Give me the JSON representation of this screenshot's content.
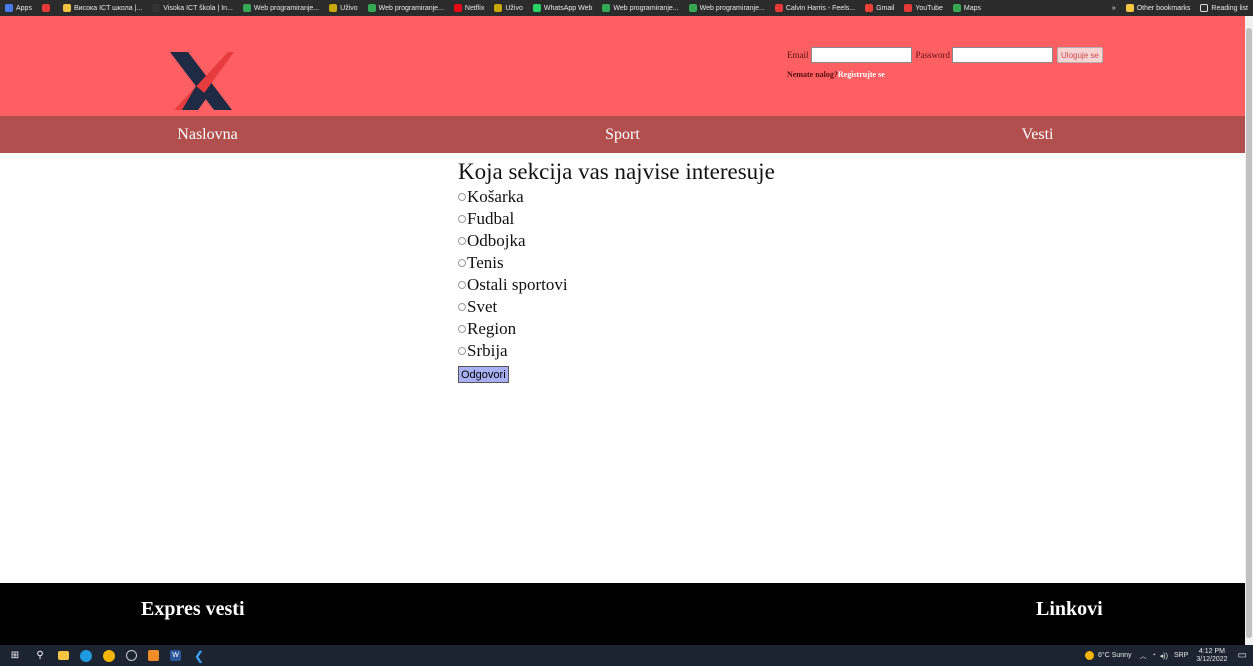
{
  "bookmarks": {
    "items": [
      {
        "label": "Apps",
        "color": "#4a7cf0"
      },
      {
        "label": "",
        "color": "#e53935"
      },
      {
        "label": "Висока ICT школа |...",
        "color": "#f0c040"
      },
      {
        "label": "Visoka ICT škola | In...",
        "color": "#333333"
      },
      {
        "label": "Web programiranje...",
        "color": "#34a853"
      },
      {
        "label": "Uživo",
        "color": "#c8a700"
      },
      {
        "label": "Web programiranje...",
        "color": "#34a853"
      },
      {
        "label": "Netflix",
        "color": "#e50914"
      },
      {
        "label": "Uživo",
        "color": "#c8a700"
      },
      {
        "label": "WhatsApp Web",
        "color": "#25d366"
      },
      {
        "label": "Web programiranje...",
        "color": "#34a853"
      },
      {
        "label": "Web programiranje...",
        "color": "#34a853"
      },
      {
        "label": "Calvin Harris - Feels...",
        "color": "#e53935"
      },
      {
        "label": "Gmail",
        "color": "#ea4335"
      },
      {
        "label": "YouTube",
        "color": "#e53935"
      },
      {
        "label": "Maps",
        "color": "#34a853"
      }
    ],
    "more": "»",
    "other_bookmarks": "Other bookmarks",
    "reading_list": "Reading list"
  },
  "header": {
    "login": {
      "email_label": "Email",
      "password_label": "Password",
      "submit_label": "Uloguje se",
      "no_account_text": "Nemate nalog?",
      "register_link": "Registrujte se"
    },
    "logo_colors": {
      "dark": "#1f2a44",
      "accent": "#e63b3f"
    }
  },
  "nav": {
    "items": [
      {
        "label": "Naslovna"
      },
      {
        "label": "Sport"
      },
      {
        "label": "Vesti"
      }
    ]
  },
  "survey": {
    "question": "Koja sekcija vas najvise interesuje",
    "options": [
      "Košarka",
      "Fudbal",
      "Odbojka",
      "Tenis",
      "Ostali sportovi",
      "Svet",
      "Region",
      "Srbija"
    ],
    "submit_label": "Odgovori"
  },
  "footer": {
    "left_heading": "Expres vesti",
    "right_heading": "Linkovi"
  },
  "taskbar": {
    "weather": "6°C Sunny",
    "language": "SRP",
    "time": "4:12 PM",
    "date": "3/12/2022"
  },
  "colors": {
    "header_bg": "#fd5f62",
    "nav_bg": "#b14f4f",
    "footer_bg": "#000000",
    "button_bg": "#aab0f4"
  }
}
